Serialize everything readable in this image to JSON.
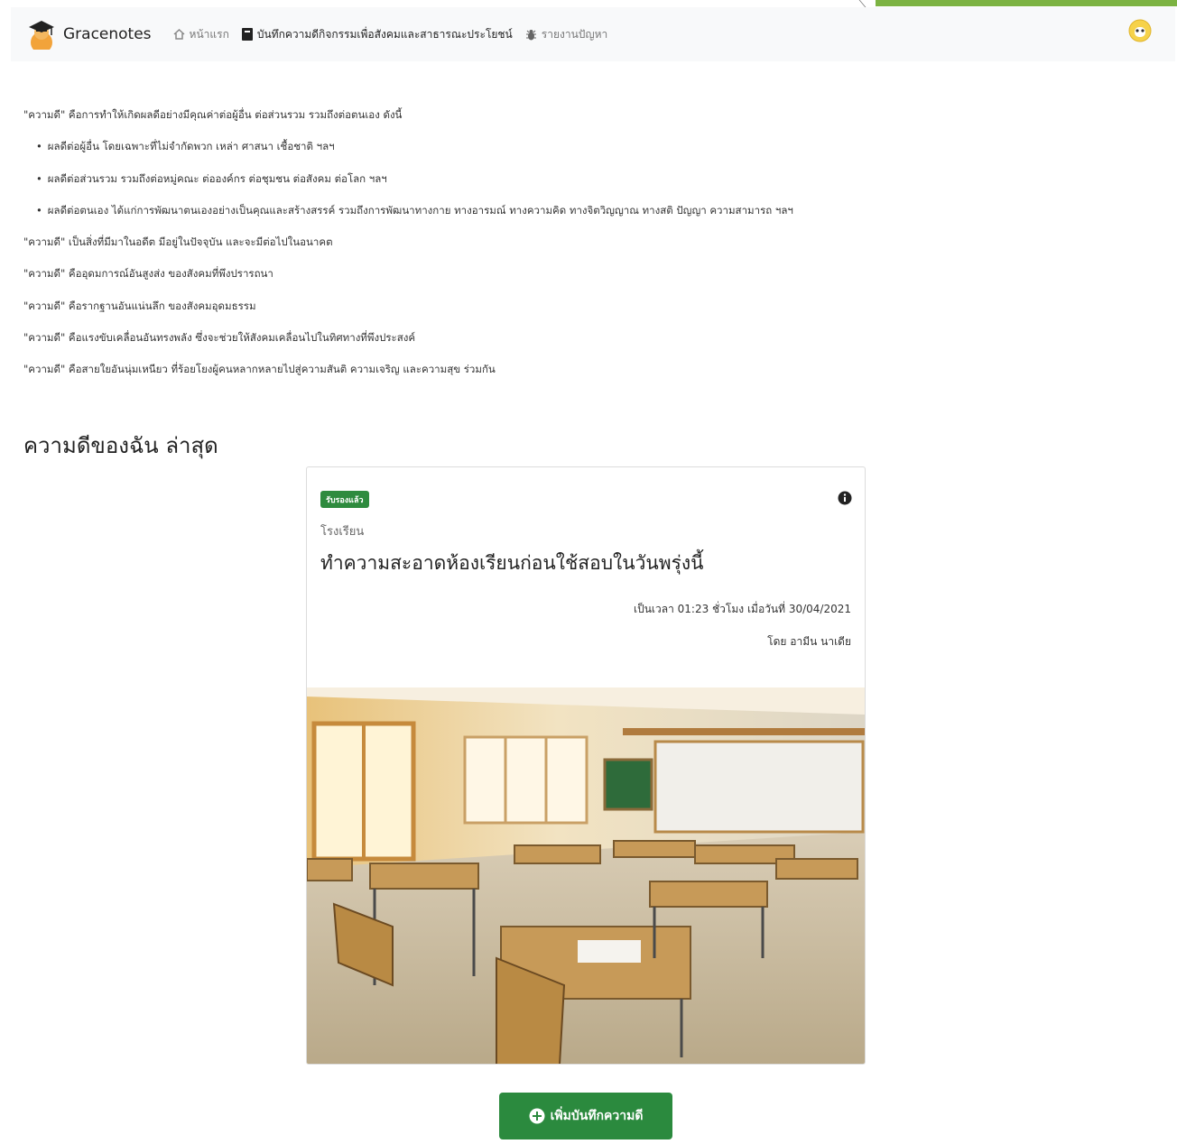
{
  "brand": {
    "name": "Gracenotes"
  },
  "nav": {
    "items": [
      {
        "label": "หน้าแรก",
        "icon": "home-icon"
      },
      {
        "label": "บันทึกความดีกิจกรรมเพื่อสังคมและสาธารณะประโยชน์",
        "icon": "book-icon"
      },
      {
        "label": "รายงานปัญหา",
        "icon": "bug-icon"
      }
    ]
  },
  "intro": {
    "lines": [
      "\"ความดี\" คือการทำให้เกิดผลดีอย่างมีคุณค่าต่อผู้อื่น ต่อส่วนรวม รวมถึงต่อตนเอง ดังนี้",
      "ผลดีต่อผู้อื่น โดยเฉพาะที่ไม่จำกัดพวก เหล่า ศาสนา เชื้อชาติ ฯลฯ",
      "ผลดีต่อส่วนรวม รวมถึงต่อหมู่คณะ ต่อองค์กร ต่อชุมชน ต่อสังคม ต่อโลก ฯลฯ",
      "ผลดีต่อตนเอง ได้แก่การพัฒนาตนเองอย่างเป็นคุณและสร้างสรรค์ รวมถึงการพัฒนาทางกาย ทางอารมณ์ ทางความคิด ทางจิตวิญญาณ ทางสติ ปัญญา ความสามารถ ฯลฯ",
      "\"ความดี\" เป็นสิ่งที่มีมาในอดีต มีอยู่ในปัจจุบัน และจะมีต่อไปในอนาคต",
      "\"ความดี\" คืออุดมการณ์อันสูงส่ง ของสังคมที่พึงปรารถนา",
      "\"ความดี\" คือรากฐานอันแน่นลึก ของสังคมอุดมธรรม",
      "\"ความดี\" คือแรงขับเคลื่อนอันทรงพลัง ซึ่งจะช่วยให้สังคมเคลื่อนไปในทิศทางที่พึงประสงค์",
      "\"ความดี\" คือสายใยอันนุ่มเหนียว ที่ร้อยโยงผู้คนหลากหลายไปสู่ความสันติ ความเจริญ และความสุข ร่วมกัน"
    ]
  },
  "section": {
    "title": "ความดีของฉัน ล่าสุด"
  },
  "card": {
    "badge": "รับรองแล้ว",
    "category": "โรงเรียน",
    "title": "ทำความสะอาดห้องเรียนก่อนใช้สอบในวันพรุ่งนี้",
    "time": "เป็นเวลา 01:23 ชั่วโมง เมื่อวันที่ 30/04/2021",
    "author": "โดย อามีน นาเดีย"
  },
  "add_button": {
    "label": "เพิ่มบันทึกความดี"
  },
  "colors": {
    "accent": "#2b8a3e",
    "topbar": "#7cb342",
    "navbar_bg": "#f8f9fa"
  }
}
